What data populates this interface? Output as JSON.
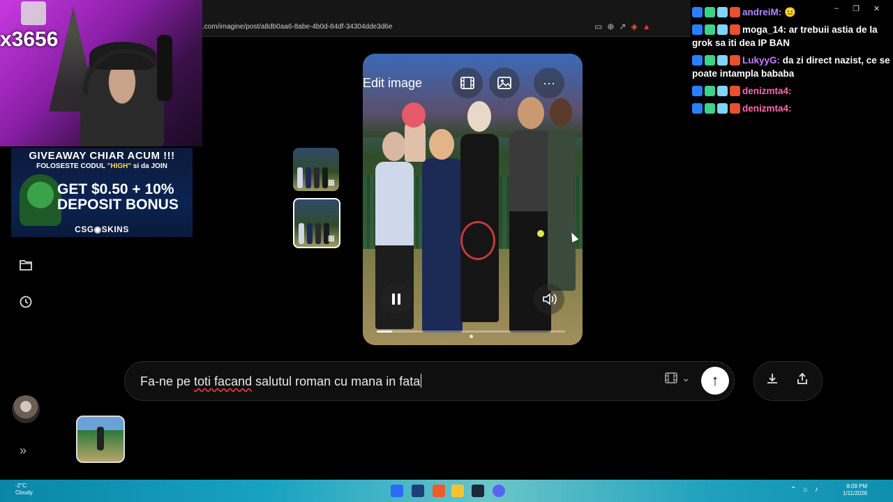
{
  "browser": {
    "url": ".com/imagine/post/a8db0aa6-8abe-4b0d-84df-34304dde3d6e",
    "url_icons": [
      "cast-icon",
      "zoom-icon",
      "share-icon",
      "brave-shield-icon",
      "rewards-icon"
    ],
    "window_controls": [
      "minimize-icon",
      "maximize-icon",
      "close-icon"
    ]
  },
  "stream": {
    "cam_name": "x3656",
    "giveaway": {
      "line1": "GIVEAWAY CHIAR ACUM !!!",
      "line2_pre": "FOLOSESTE CODUL ",
      "line2_code": "\"HIGH\"",
      "line2_post": " si da JOIN",
      "line3": "GET $0.50 + 10%",
      "line4": "DEPOSIT BONUS",
      "brand": "CSG◉SKINS"
    }
  },
  "nav": {
    "folder_icon": "folder-icon",
    "history_icon": "history-icon",
    "expand": "»"
  },
  "viewer": {
    "edit_label": "Edit image",
    "progress": 0.08,
    "more": "···"
  },
  "chat": {
    "messages": [
      {
        "nick": "andreiM:",
        "nick_color": "#b088ff",
        "text": "😐"
      },
      {
        "nick": "moga_14:",
        "nick_color": "#ffffff",
        "text": "ar trebuii astia de la grok sa iti dea IP BAN"
      },
      {
        "nick": "LukyyG:",
        "nick_color": "#c77dff",
        "text": "da zi direct nazist, ce se poate intampla bababa"
      },
      {
        "nick": "denizmta4:",
        "nick_color": "#ff6ab0",
        "text": ""
      },
      {
        "nick": "denizmta4:",
        "nick_color": "#ff6ab0",
        "text": ""
      }
    ]
  },
  "prompt": {
    "text_pre": "Fa-ne pe ",
    "text_misspelled": "toti facand",
    "text_post": " salutul roman cu mana in fata"
  },
  "taskbar": {
    "weather_temp": "-2°C",
    "weather_desc": "Cloudy",
    "time": "8:09 PM",
    "date": "1/11/2026"
  },
  "colors": {
    "accent": "#ffffff",
    "taskbar": "#18a2c2"
  }
}
